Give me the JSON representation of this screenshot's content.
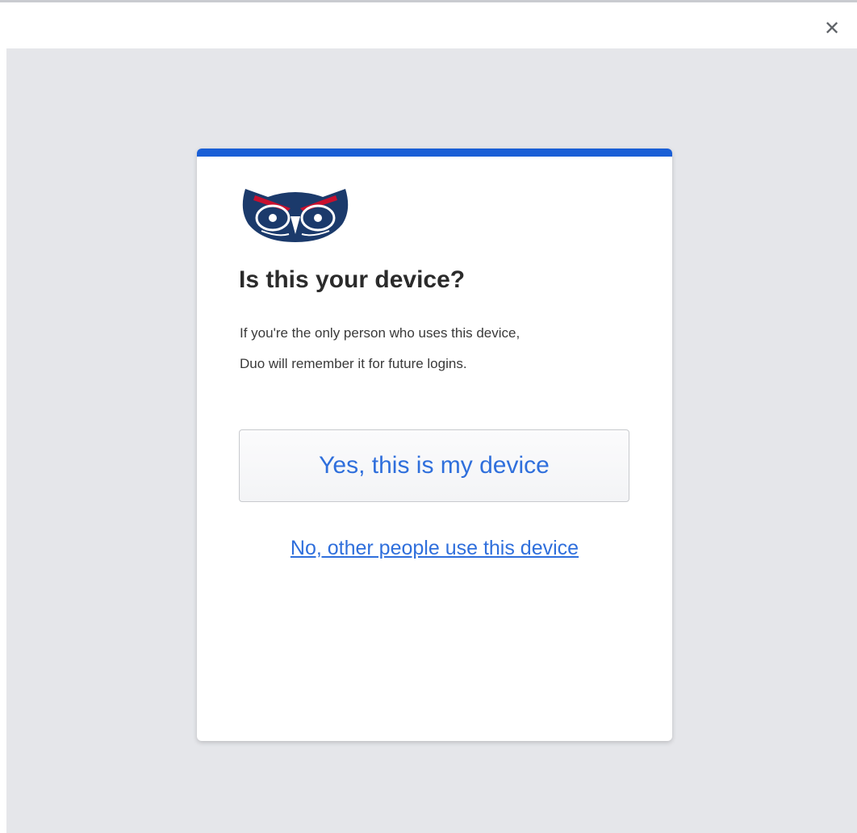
{
  "window": {
    "close_icon": "close-icon",
    "close_glyph": "✕"
  },
  "prompt": {
    "logo_icon": "owl-logo-icon",
    "heading": "Is this your device?",
    "description_line1": "If you're the only person who uses this device,",
    "description_line2": "Duo will remember it for future logins.",
    "yes_button_label": "Yes, this is my device",
    "no_link_label": "No, other people use this device"
  },
  "colors": {
    "accent": "#1a5fd6",
    "link": "#2f6fdc",
    "logo_navy": "#1b3a6b",
    "logo_red": "#c8102e",
    "backdrop": "#e5e6ea"
  }
}
